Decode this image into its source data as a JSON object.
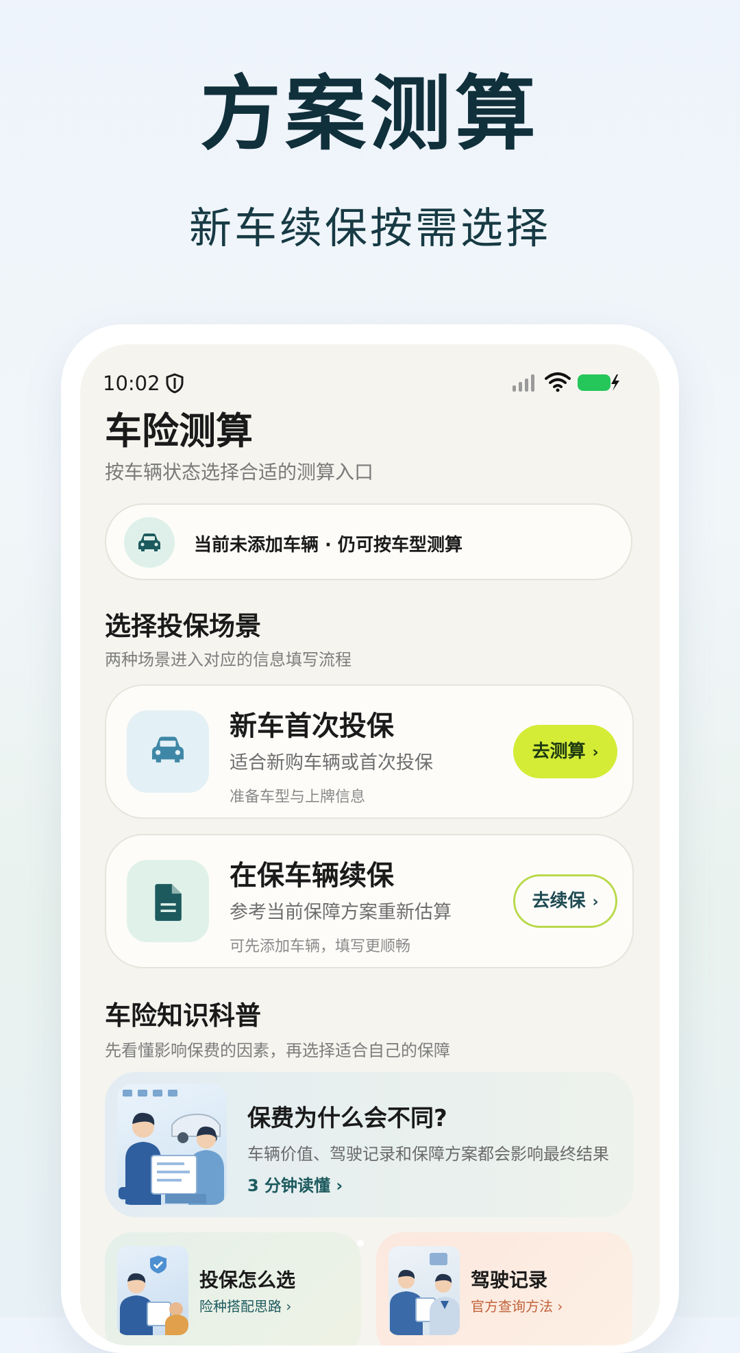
{
  "hero": {
    "title": "方案测算",
    "subtitle": "新车续保按需选择"
  },
  "status_bar": {
    "time": "10:02",
    "icons": [
      "shield-icon",
      "signal-icon",
      "wifi-icon",
      "battery-charging-icon"
    ],
    "battery_color": "#25c65a"
  },
  "header": {
    "title": "车险测算",
    "description": "按车辆状态选择合适的测算入口"
  },
  "vehicle_banner": {
    "icon": "car-icon",
    "text": "当前未添加车辆 · 仍可按车型测算"
  },
  "scene_section": {
    "title": "选择投保场景",
    "description": "两种场景进入对应的信息填写流程"
  },
  "scenes": [
    {
      "icon": "car-icon",
      "title": "新车首次投保",
      "description": "适合新购车辆或首次投保",
      "note": "准备车型与上牌信息",
      "button": "去测算",
      "button_chevron": "›"
    },
    {
      "icon": "document-icon",
      "title": "在保车辆续保",
      "description": "参考当前保障方案重新估算",
      "note": "可先添加车辆，填写更顺畅",
      "button": "去续保",
      "button_chevron": "›"
    }
  ],
  "knowledge_section": {
    "title": "车险知识科普",
    "description": "先看懂影响保费的因素，再选择适合自己的保障"
  },
  "article": {
    "title": "保费为什么会不同?",
    "description": "车辆价值、驾驶记录和保障方案都会影响最终结果",
    "link": "3 分钟读懂",
    "link_chevron": "›"
  },
  "mini_cards": [
    {
      "title": "投保怎么选",
      "link": "险种搭配思路",
      "link_chevron": "›"
    },
    {
      "title": "驾驶记录",
      "link": "官方查询方法",
      "link_chevron": "›"
    }
  ],
  "colors": {
    "accent": "#d4ec36",
    "brand": "#1c5a5e",
    "background": "#f5f4ef"
  }
}
